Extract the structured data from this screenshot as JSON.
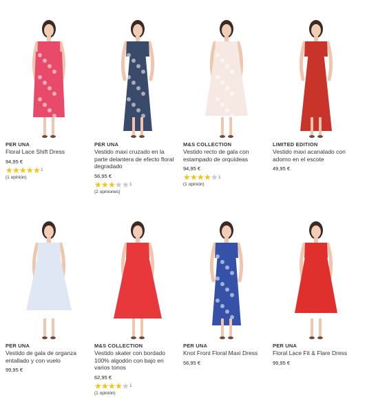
{
  "products": [
    {
      "brand": "PER UNA",
      "name": "Floral Lace Shift Dress",
      "price": "94,95 €",
      "rating": 5,
      "rating_count": "1",
      "reviews": "(1 opinión)"
    },
    {
      "brand": "PER UNA",
      "name": "Vestido maxi cruzado en la parte delantera de efecto floral degradado",
      "price": "56,95 €",
      "rating": 3,
      "rating_count": "1",
      "reviews": "(2 opiniones)"
    },
    {
      "brand": "M&S COLLECTION",
      "name": "Vestido recto de gala con estampado de orquídeas",
      "price": "94,95 €",
      "rating": 4,
      "rating_count": "1",
      "reviews": "(1 opinión)"
    },
    {
      "brand": "LIMITED EDITION",
      "name": "Vestido maxi acanalado con adorno en el escote",
      "price": "49,95 €",
      "rating": null,
      "rating_count": "",
      "reviews": ""
    },
    {
      "brand": "PER UNA",
      "name": "Vestido de gala de organza entallado y con vuelo",
      "price": "99,95 €",
      "rating": null,
      "rating_count": "",
      "reviews": ""
    },
    {
      "brand": "M&S COLLECTION",
      "name": "Vestido skater con bordado 100% algodón con bajo en varios tonos",
      "price": "62,95 €",
      "rating": 4,
      "rating_count": "1",
      "reviews": "(1 opinión)"
    },
    {
      "brand": "PER UNA",
      "name": "Knot Front Floral Maxi Dress",
      "price": "56,95 €",
      "rating": null,
      "rating_count": "",
      "reviews": ""
    },
    {
      "brand": "PER UNA",
      "name": "Floral Lace Fit & Flare Dress",
      "price": "99,95 €",
      "rating": null,
      "rating_count": "",
      "reviews": ""
    }
  ],
  "icons": {
    "product_image": "model-dress-photo",
    "rating_star": "star-icon"
  },
  "colors": {
    "star_filled": "#f3c212",
    "star_empty": "#c8c8c8",
    "dress_1": "#e84a6a",
    "dress_2": "#3a4a6a",
    "dress_3": "#f6e9e4",
    "dress_4": "#c8342a",
    "dress_5": "#dfe6f4",
    "dress_6": "#e8383c",
    "dress_7": "#3552a8",
    "dress_8": "#e0302e"
  }
}
